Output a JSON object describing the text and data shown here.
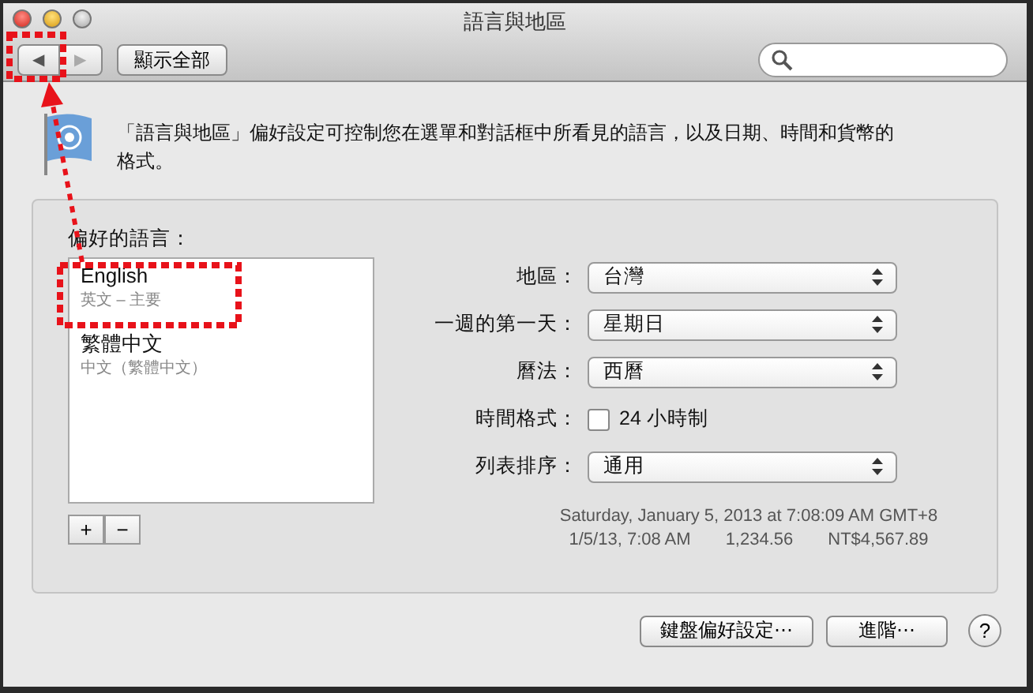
{
  "window": {
    "title": "語言與地區"
  },
  "toolbar": {
    "back": "◀",
    "forward": "▶",
    "show_all": "顯示全部"
  },
  "description": "「語言與地區」偏好設定可控制您在選單和對話框中所看見的語言，以及日期、時間和貨幣的格式。",
  "languages": {
    "label": "偏好的語言：",
    "items": [
      {
        "name": "English",
        "detail": "英文 – 主要"
      },
      {
        "name": "繁體中文",
        "detail": "中文（繁體中文）"
      }
    ],
    "add": "+",
    "remove": "−"
  },
  "settings": [
    {
      "kind": "popup",
      "label": "地區：",
      "value": "台灣"
    },
    {
      "kind": "popup",
      "label": "一週的第一天：",
      "value": "星期日"
    },
    {
      "kind": "popup",
      "label": "曆法：",
      "value": "西曆"
    },
    {
      "kind": "checkbox",
      "label": "時間格式：",
      "value": "24 小時制",
      "checked": false
    },
    {
      "kind": "popup",
      "label": "列表排序：",
      "value": "通用"
    }
  ],
  "samples": [
    "Saturday, January 5, 2013 at 7:08:09 AM GMT+8",
    [
      "1/5/13, 7:08 AM",
      "1,234.56",
      "NT$4,567.89"
    ]
  ],
  "buttons": {
    "keyboard": "鍵盤偏好設定⋯",
    "advanced": "進階⋯",
    "help": "?"
  }
}
